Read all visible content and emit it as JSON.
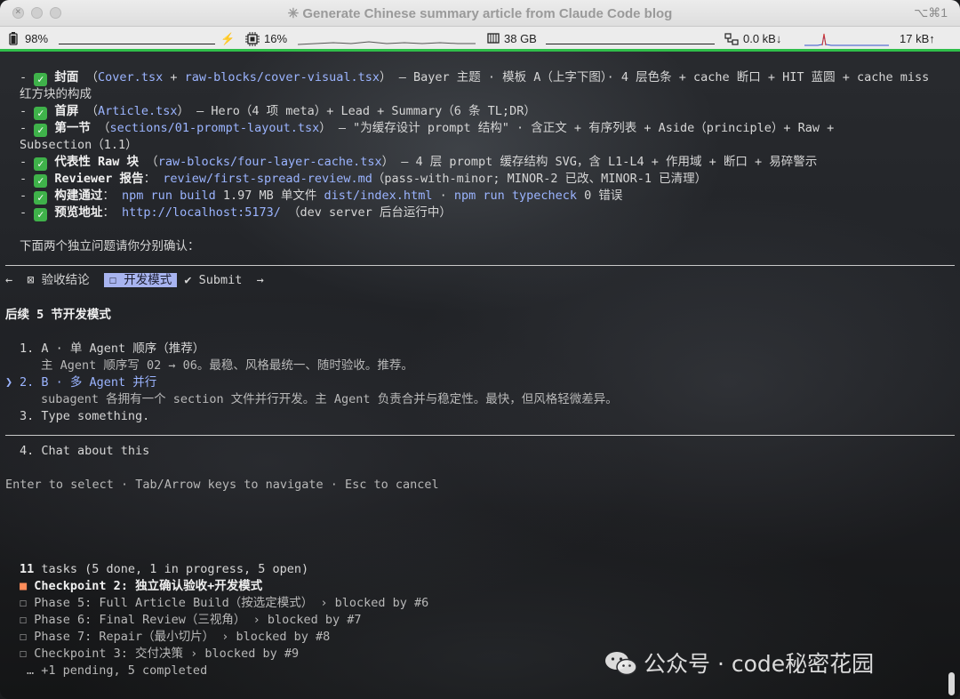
{
  "window": {
    "title": "✳ Generate Chinese summary article from Claude Code blog",
    "shortcut": "⌥⌘1"
  },
  "statusbar": {
    "battery": "98%",
    "battery_level": 0.98,
    "cpu": "16%",
    "memory": "38 GB",
    "net_down": "0.0 kB↓",
    "net_up": "17 kB↑"
  },
  "terminal": {
    "lines": {
      "cover_a": "封面",
      "cover_b1": "Cover.tsx",
      "cover_b2": "raw-blocks/cover-visual.tsx",
      "cover_rest": "— Bayer 主题 · 模板 A（上字下图）· 4 层色条 + cache 断口 + HIT 蓝圆 + cache miss",
      "cover_cont": "红方块的构成",
      "home_a": "首屏",
      "home_link": "Article.tsx",
      "home_rest": "— Hero（4 项 meta）+ Lead + Summary（6 条 TL;DR）",
      "sec1_a": "第一节",
      "sec1_link": "sections/01-prompt-layout.tsx",
      "sec1_rest": "— \"为缓存设计 prompt 结构\" · 含正文 + 有序列表 + Aside（principle）+ Raw +",
      "sec1_cont": "Subsection（1.1）",
      "raw_a": "代表性 Raw 块",
      "raw_link": "raw-blocks/four-layer-cache.tsx",
      "raw_rest": "— 4 层 prompt 缓存结构 SVG，含 L1-L4 + 作用域 + 断口 + 易碎警示",
      "rev_a": "Reviewer 报告",
      "rev_link": "review/first-spread-review.md",
      "rev_rest": "（pass-with-minor; MINOR-2 已改、MINOR-1 已清理）",
      "build_a": "构建通过",
      "build_link1": "npm run build",
      "build_mid": "1.97 MB 单文件",
      "build_link2": "dist/index.html",
      "build_link3": "npm run typecheck",
      "build_end": "0 错误",
      "preview_a": "预览地址",
      "preview_link": "http://localhost:5173/",
      "preview_rest": "（dev server 后台运行中）",
      "ask": "下面两个独立问题请你分别确认："
    },
    "tabs": {
      "left_arrow": "←",
      "tab1": "⊠ 验收结论",
      "tab2": "☐ 开发模式",
      "submit": "✔ Submit",
      "right_arrow": "→"
    },
    "question": {
      "title": "后续 5 节开发模式",
      "opt1": "1. A · 单 Agent 顺序（推荐）",
      "opt1_desc": "主 Agent 顺序写 02 → 06。最稳、风格最统一、随时验收。推荐。",
      "opt2": "2. B · 多 Agent 并行",
      "opt2_desc": "subagent 各拥有一个 section 文件并行开发。主 Agent 负责合并与稳定性。最快，但风格轻微差异。",
      "opt3": "3. Type something.",
      "opt4": "4. Chat about this",
      "cursor": "❯",
      "hint": "Enter to select · Tab/Arrow keys to navigate · Esc to cancel"
    },
    "tasks": {
      "summary_n": "11",
      "summary_rest": " tasks (5 done, 1 in progress, 5 open)",
      "summary_1": "1",
      "summary_5": "5",
      "current": "Checkpoint 2: 独立确认验收+开发模式",
      "t1": "☐ Phase 5: Full Article Build（按选定模式） › blocked by #6",
      "t2": "☐ Phase 6: Final Review（三视角） › blocked by #7",
      "t3": "☐ Phase 7: Repair（最小切片） › blocked by #8",
      "t4": "☐ Checkpoint 3: 交付决策 › blocked by #9",
      "more": "… +1 pending, 5 completed"
    }
  },
  "watermark": "公众号 · code秘密花园",
  "colors": {
    "accent": "#2fbe4a",
    "link": "#9bb4ff",
    "tab_bg": "#a8b4f0",
    "in_progress": "#ff8c5a"
  }
}
